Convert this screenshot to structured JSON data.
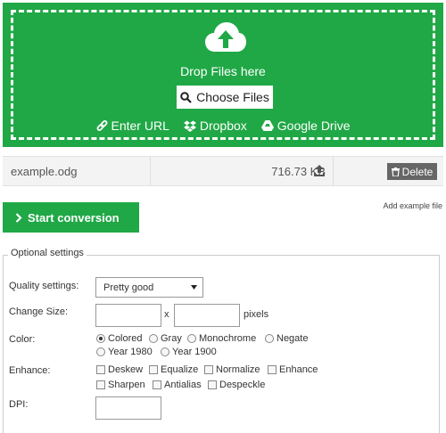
{
  "upload": {
    "drop_text": "Drop Files here",
    "choose_label": "Choose Files",
    "sources": [
      {
        "label": "Enter URL",
        "icon": "link-icon"
      },
      {
        "label": "Dropbox",
        "icon": "dropbox-icon"
      },
      {
        "label": "Google Drive",
        "icon": "google-drive-icon"
      }
    ]
  },
  "file": {
    "name": "example.odg",
    "size": "716.73 KB",
    "delete_label": "Delete"
  },
  "actions": {
    "start_label": "Start conversion",
    "add_example_label": "Add example file"
  },
  "settings": {
    "legend": "Optional settings",
    "quality": {
      "label": "Quality settings:",
      "selected": "Pretty good"
    },
    "size": {
      "label": "Change Size:",
      "separator": "x",
      "unit": "pixels",
      "width": "",
      "height": ""
    },
    "color": {
      "label": "Color:",
      "options": [
        "Colored",
        "Gray",
        "Monochrome",
        "Negate",
        "Year 1980",
        "Year 1900"
      ],
      "selected": "Colored"
    },
    "enhance": {
      "label": "Enhance:",
      "options": [
        "Deskew",
        "Equalize",
        "Normalize",
        "Enhance",
        "Sharpen",
        "Antialias",
        "Despeckle"
      ]
    },
    "dpi": {
      "label": "DPI:",
      "value": ""
    }
  },
  "colors": {
    "accent": "#20a846",
    "delete_bg": "#666666"
  }
}
